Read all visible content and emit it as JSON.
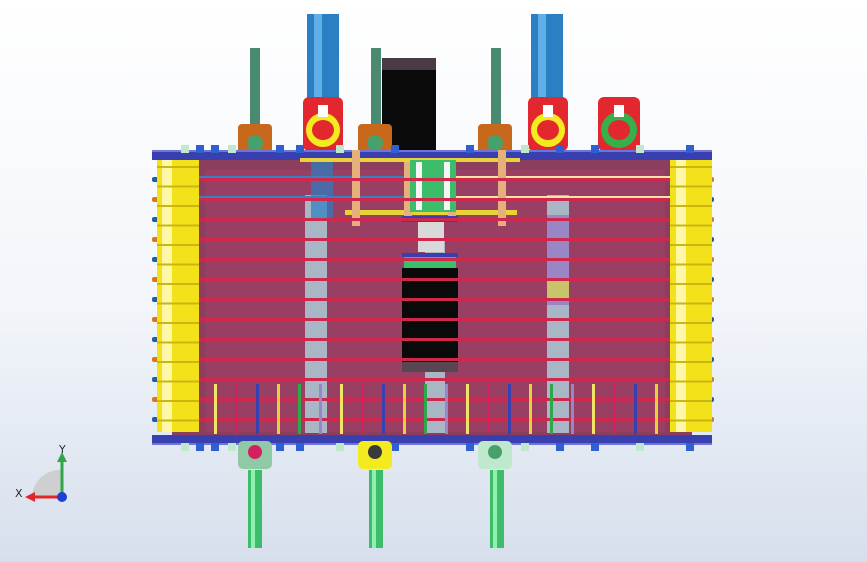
{
  "viewport": {
    "background_top": "#ffffff",
    "background_bottom": "#d6dfec"
  },
  "colors": {
    "frame": "#8b3e5e",
    "frame_dark": "#6a2643",
    "rod_red": "#d0284c",
    "rod_end_blue": "#1e5fa8",
    "rod_end_orange": "#d47a1a",
    "coil_yellow": "#f3e21a",
    "plate_blue": "#3a3fb0",
    "cylinder_blue": "#2b7fc3",
    "shaft_green": "#3dbd6a",
    "column_gray": "#a8b6c6",
    "core_black": "#0a0a0a",
    "valve_red": "#e2282e",
    "valve_yellow": "#f4ea20",
    "valve_green": "#37b04a",
    "gear_orange": "#c8681c",
    "beam_yellow": "#e8d23a"
  },
  "triad": {
    "x_label": "X",
    "y_label": "Y",
    "x_color": "#e0262b",
    "y_color": "#2fa64a",
    "z_color": "#1f3ed2"
  },
  "icons": {
    "triad": "axis-triad-icon"
  }
}
